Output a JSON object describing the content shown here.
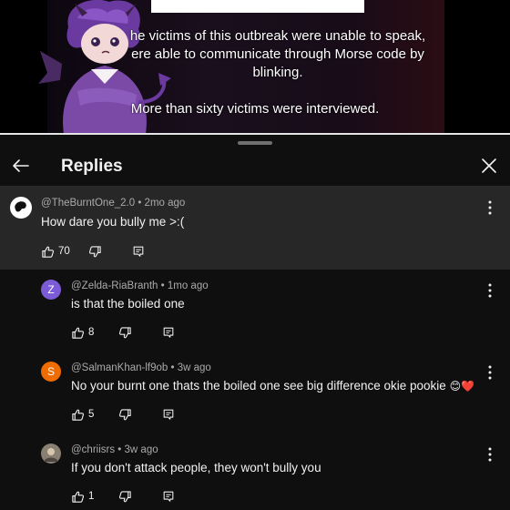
{
  "video": {
    "caption_line1": "he victims of this outbreak were unable to speak,",
    "caption_line2": "ere able to communicate through Morse code by",
    "caption_line3": "blinking.",
    "caption_line4": "More than sixty victims were interviewed."
  },
  "header": {
    "title": "Replies",
    "back_icon": "arrow-left-icon",
    "close_icon": "close-icon"
  },
  "main_comment": {
    "author": "@TheBurntOne_2.0",
    "age": "2mo ago",
    "text": "How dare you bully me >:(",
    "likes": "70"
  },
  "replies": [
    {
      "author": "@Zelda-RiaBranth",
      "age": "1mo ago",
      "text": "is that the  boiled one",
      "likes": "8",
      "avatar_letter": "Z",
      "avatar_color": "#7b5bd6"
    },
    {
      "author": "@SalmanKhan-lf9ob",
      "age": "3w ago",
      "text": "No your burnt one thats the boiled one see big difference okie pookie",
      "emoji": "😊❤️",
      "likes": "5",
      "avatar_letter": "S",
      "avatar_color": "#ef6c00"
    },
    {
      "author": "@chriisrs",
      "age": "3w ago",
      "text": "If you don't attack people, they won't bully you",
      "likes": "1",
      "avatar_letter": "",
      "avatar_color": "#8a8072"
    }
  ],
  "colors": {
    "background": "#0f0f0f",
    "highlight": "#272727",
    "meta": "#aaaaaa"
  }
}
